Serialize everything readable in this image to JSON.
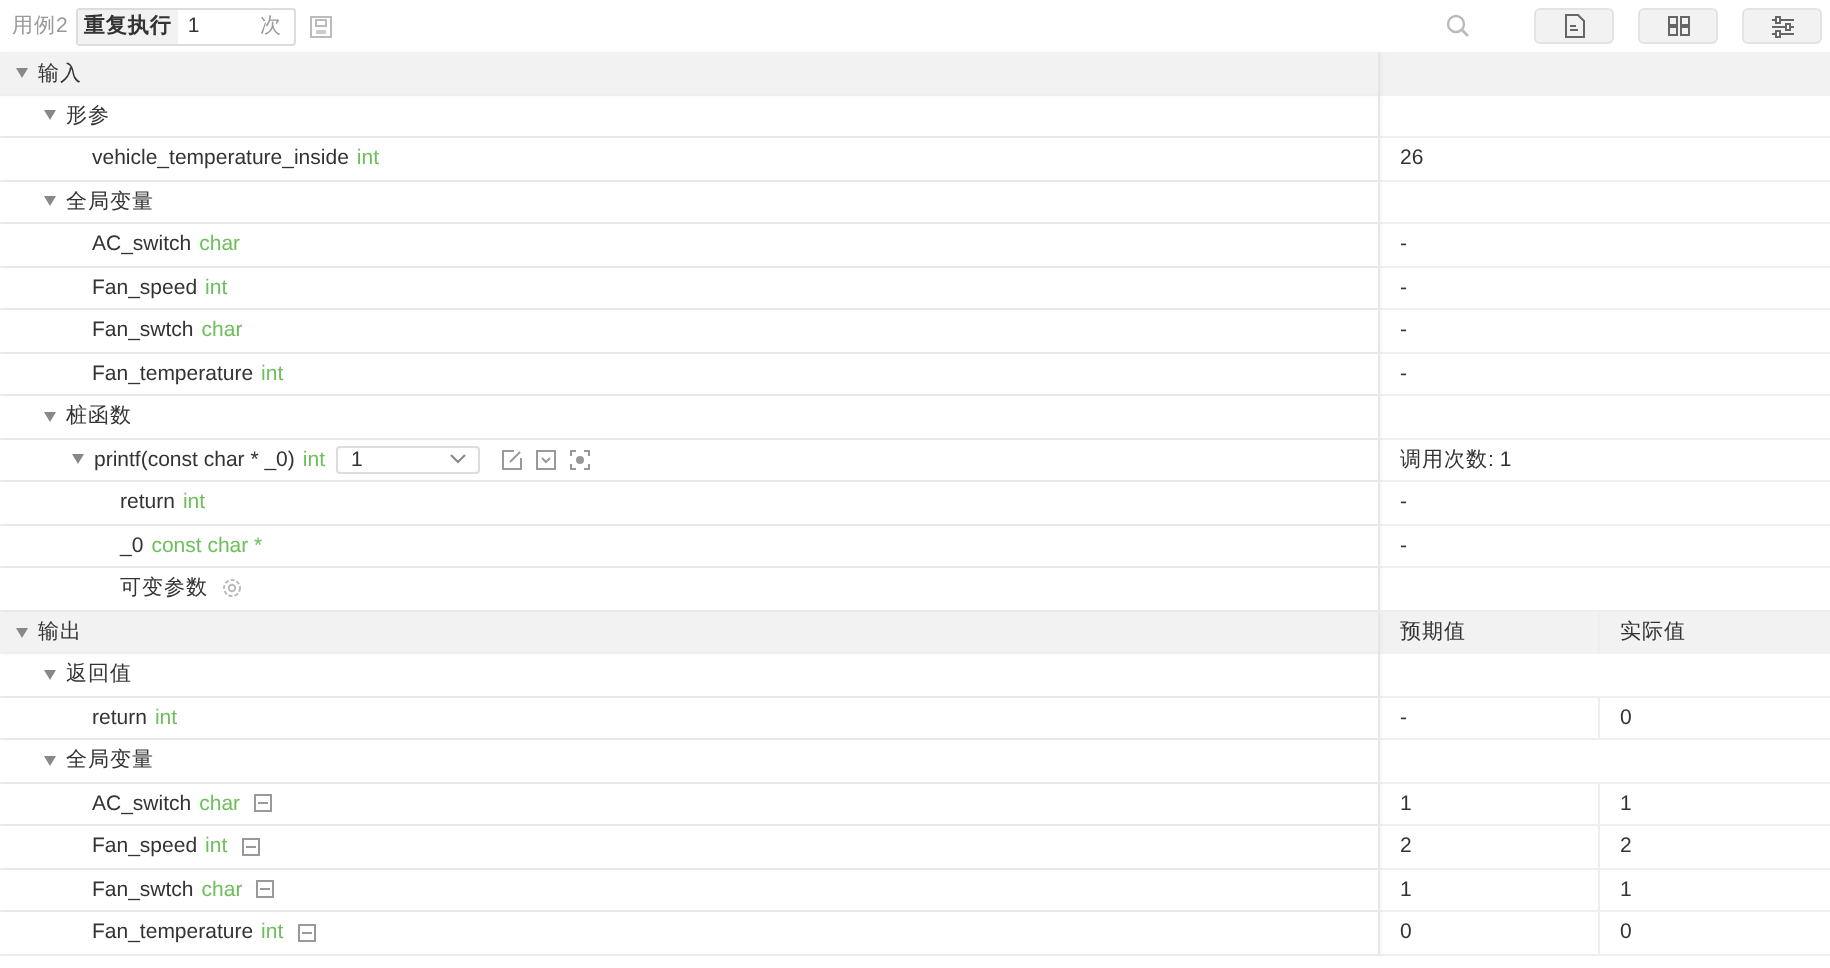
{
  "toolbar": {
    "case_label": "用例2",
    "repeat_label": "重复执行",
    "repeat_count": "1",
    "repeat_unit": "次"
  },
  "tree": [
    {
      "label": "输入",
      "expanded": true,
      "children": [
        {
          "label": "形参",
          "expanded": true,
          "children": [
            {
              "kind": "var",
              "name": "vehicle_temperature_inside",
              "type": "int",
              "values": [
                "26"
              ]
            }
          ]
        },
        {
          "label": "全局变量",
          "expanded": true,
          "children": [
            {
              "kind": "var",
              "name": "AC_switch",
              "type": "char",
              "values": [
                "-"
              ]
            },
            {
              "kind": "var",
              "name": "Fan_speed",
              "type": "int",
              "values": [
                "-"
              ]
            },
            {
              "kind": "var",
              "name": "Fan_swtch",
              "type": "char",
              "values": [
                "-"
              ]
            },
            {
              "kind": "var",
              "name": "Fan_temperature",
              "type": "int",
              "values": [
                "-"
              ]
            }
          ]
        },
        {
          "label": "桩函数",
          "expanded": true,
          "children": [
            {
              "kind": "stub",
              "name": "printf(const char * _0)",
              "type": "int",
              "select_value": "1",
              "values": [
                "调用次数: 1"
              ],
              "expanded": true,
              "children": [
                {
                  "kind": "var",
                  "name": "return",
                  "type": "int",
                  "values": [
                    "-"
                  ]
                },
                {
                  "kind": "var",
                  "name": "_0",
                  "type": "const char *",
                  "values": [
                    "-"
                  ]
                },
                {
                  "kind": "varargs",
                  "name": "可变参数"
                }
              ]
            }
          ]
        }
      ]
    },
    {
      "label": "输出",
      "expanded": true,
      "values": [
        "预期值",
        "实际值"
      ],
      "children": [
        {
          "label": "返回值",
          "expanded": true,
          "children": [
            {
              "kind": "var",
              "name": "return",
              "type": "int",
              "values": [
                "-",
                "0"
              ]
            }
          ]
        },
        {
          "label": "全局变量",
          "expanded": true,
          "children": [
            {
              "kind": "output_var",
              "name": "AC_switch",
              "type": "char",
              "values": [
                "1",
                "1"
              ]
            },
            {
              "kind": "output_var",
              "name": "Fan_speed",
              "type": "int",
              "values": [
                "2",
                "2"
              ]
            },
            {
              "kind": "output_var",
              "name": "Fan_swtch",
              "type": "char",
              "values": [
                "1",
                "1"
              ]
            },
            {
              "kind": "output_var",
              "name": "Fan_temperature",
              "type": "int",
              "values": [
                "0",
                "0"
              ]
            }
          ]
        }
      ]
    }
  ]
}
